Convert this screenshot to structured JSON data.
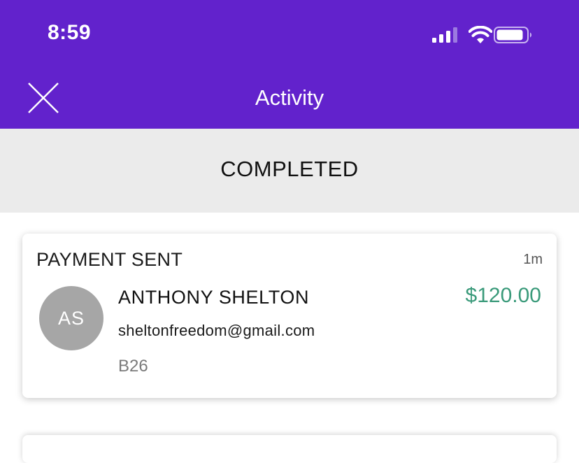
{
  "status_bar": {
    "time": "8:59",
    "icons": [
      "signal-icon",
      "wifi-icon",
      "battery-icon"
    ]
  },
  "nav": {
    "title": "Activity",
    "close_icon": "close-icon"
  },
  "section": {
    "label": "COMPLETED"
  },
  "activity_items": [
    {
      "type": "PAYMENT SENT",
      "time_ago": "1m",
      "avatar_initials": "AS",
      "name": "ANTHONY SHELTON",
      "amount": "$120.00",
      "email": "sheltonfreedom@gmail.com",
      "memo": "B26"
    }
  ],
  "colors": {
    "header_bg": "#6222cc",
    "section_bg": "#ebebeb",
    "amount": "#3a9a7a",
    "avatar_bg": "#a6a6a6"
  }
}
